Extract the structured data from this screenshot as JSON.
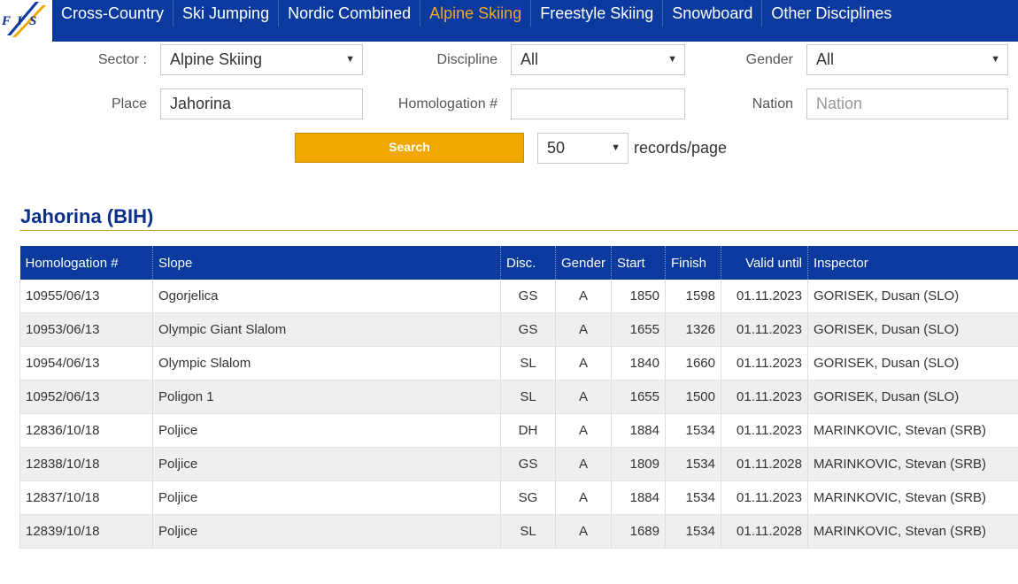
{
  "nav": {
    "logo_text": "FIS",
    "items": [
      {
        "label": "Cross-Country"
      },
      {
        "label": "Ski Jumping"
      },
      {
        "label": "Nordic Combined"
      },
      {
        "label": "Alpine Skiing",
        "active": true
      },
      {
        "label": "Freestyle Skiing"
      },
      {
        "label": "Snowboard"
      },
      {
        "label": "Other Disciplines"
      }
    ],
    "active_color": "#f5a623",
    "bar_color": "#0a3a9e"
  },
  "filters": {
    "sector": {
      "label": "Sector :",
      "value": "Alpine Skiing"
    },
    "discipline": {
      "label": "Discipline",
      "value": "All"
    },
    "gender": {
      "label": "Gender",
      "value": "All"
    },
    "place": {
      "label": "Place",
      "value": "Jahorina"
    },
    "homologation": {
      "label": "Homologation #",
      "value": ""
    },
    "nation": {
      "label": "Nation",
      "placeholder": "Nation"
    },
    "search_label": "Search",
    "records_per_page": {
      "value": "50",
      "label": "records/page"
    }
  },
  "results": {
    "title": "Jahorina (BIH)",
    "columns": [
      "Homologation #",
      "Slope",
      "Disc.",
      "Gender",
      "Start",
      "Finish",
      "Valid until",
      "Inspector"
    ],
    "rows": [
      [
        "10955/06/13",
        "Ogorjelica",
        "GS",
        "A",
        "1850",
        "1598",
        "01.11.2023",
        "GORISEK, Dusan (SLO)"
      ],
      [
        "10953/06/13",
        "Olympic Giant Slalom",
        "GS",
        "A",
        "1655",
        "1326",
        "01.11.2023",
        "GORISEK, Dusan (SLO)"
      ],
      [
        "10954/06/13",
        "Olympic Slalom",
        "SL",
        "A",
        "1840",
        "1660",
        "01.11.2023",
        "GORISEK, Dusan (SLO)"
      ],
      [
        "10952/06/13",
        "Poligon 1",
        "SL",
        "A",
        "1655",
        "1500",
        "01.11.2023",
        "GORISEK, Dusan (SLO)"
      ],
      [
        "12836/10/18",
        "Poljice",
        "DH",
        "A",
        "1884",
        "1534",
        "01.11.2023",
        "MARINKOVIC, Stevan (SRB)"
      ],
      [
        "12838/10/18",
        "Poljice",
        "GS",
        "A",
        "1809",
        "1534",
        "01.11.2028",
        "MARINKOVIC, Stevan (SRB)"
      ],
      [
        "12837/10/18",
        "Poljice",
        "SG",
        "A",
        "1884",
        "1534",
        "01.11.2023",
        "MARINKOVIC, Stevan (SRB)"
      ],
      [
        "12839/10/18",
        "Poljice",
        "SL",
        "A",
        "1689",
        "1534",
        "01.11.2028",
        "MARINKOVIC, Stevan (SRB)"
      ]
    ]
  }
}
